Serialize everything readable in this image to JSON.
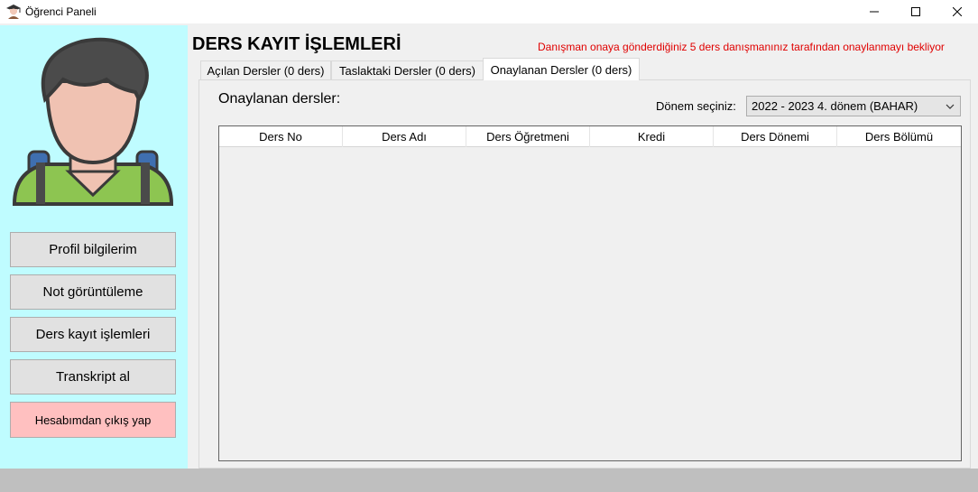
{
  "window": {
    "title": "Öğrenci Paneli"
  },
  "sidebar": {
    "buttons": [
      {
        "label": "Profil bilgilerim"
      },
      {
        "label": "Not görüntüleme"
      },
      {
        "label": "Ders kayıt işlemleri"
      },
      {
        "label": "Transkript al"
      },
      {
        "label": "Hesabımdan çıkış yap"
      }
    ]
  },
  "main": {
    "title": "DERS KAYIT İŞLEMLERİ",
    "status_message": "Danışman onaya gönderdiğiniz 5 ders danışmanınız tarafından onaylanmayı bekliyor",
    "tabs": [
      {
        "label": "Açılan Dersler (0 ders)"
      },
      {
        "label": "Taslaktaki Dersler (0 ders)"
      },
      {
        "label": "Onaylanan Dersler (0 ders)"
      }
    ],
    "panel": {
      "heading": "Onaylanan dersler:",
      "period_label": "Dönem seçiniz:",
      "period_selected": "2022 - 2023 4. dönem (BAHAR)",
      "columns": [
        "Ders No",
        "Ders Adı",
        "Ders Öğretmeni",
        "Kredi",
        "Ders Dönemi",
        "Ders Bölümü"
      ]
    }
  },
  "colors": {
    "sidebar_bg": "#bffcff",
    "logout_bg": "#ffc0c0",
    "status_red": "#e00000"
  }
}
